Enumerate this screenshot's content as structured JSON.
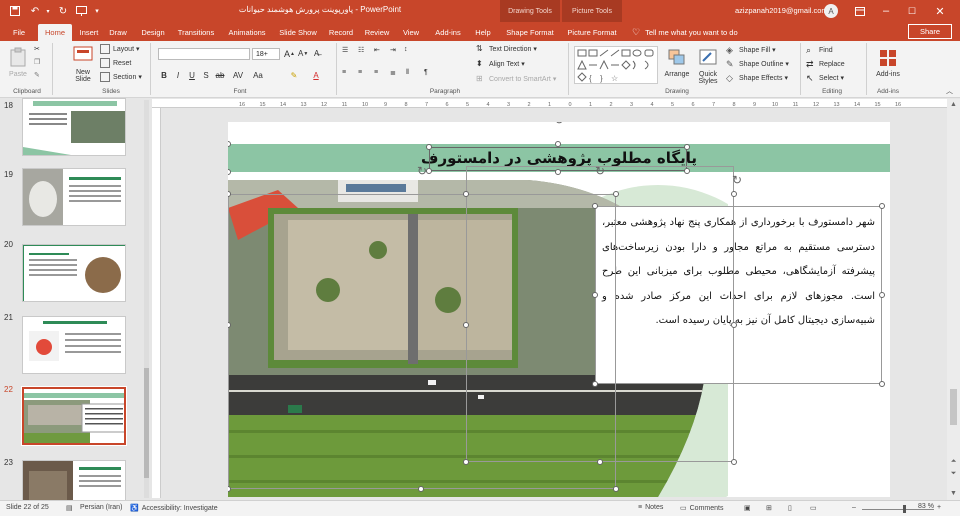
{
  "titlebar": {
    "document_title": "پاورپوینت پرورش هوشمند حیوانات  -  PowerPoint",
    "context_tab_drawing": "Drawing Tools",
    "context_tab_picture": "Picture Tools",
    "user_email": "azizpanah2019@gmail.com",
    "avatar_initial": "A"
  },
  "tabs": {
    "file": "File",
    "home": "Home",
    "insert": "Insert",
    "draw": "Draw",
    "design": "Design",
    "transitions": "Transitions",
    "animations": "Animations",
    "slideshow": "Slide Show",
    "record": "Record",
    "review": "Review",
    "view": "View",
    "addins": "Add-ins",
    "help": "Help",
    "shape_format": "Shape Format",
    "picture_format": "Picture Format",
    "tell_me": "Tell me what you want to do",
    "share": "Share"
  },
  "ribbon": {
    "paste": "Paste",
    "new_slide": "New Slide",
    "layout": "Layout",
    "reset": "Reset",
    "section": "Section",
    "font_size": "18+",
    "text_direction": "Text Direction",
    "align_text": "Align Text",
    "convert_smartart": "Convert to SmartArt",
    "arrange": "Arrange",
    "quick_styles": "Quick Styles",
    "shape_fill": "Shape Fill",
    "shape_outline": "Shape Outline",
    "shape_effects": "Shape Effects",
    "find": "Find",
    "replace": "Replace",
    "select": "Select",
    "addins": "Add-ins",
    "groups": {
      "clipboard": "Clipboard",
      "slides": "Slides",
      "font": "Font",
      "paragraph": "Paragraph",
      "drawing": "Drawing",
      "editing": "Editing",
      "addins": "Add-ins"
    }
  },
  "ruler": {
    "ticks": [
      "16",
      "15",
      "14",
      "13",
      "12",
      "11",
      "10",
      "9",
      "8",
      "7",
      "6",
      "5",
      "4",
      "3",
      "2",
      "1",
      "0",
      "1",
      "2",
      "3",
      "4",
      "5",
      "6",
      "7",
      "8",
      "9",
      "10",
      "11",
      "12",
      "13",
      "14",
      "15",
      "16"
    ]
  },
  "thumbnails": [
    {
      "num": "18"
    },
    {
      "num": "19"
    },
    {
      "num": "20"
    },
    {
      "num": "21"
    },
    {
      "num": "22",
      "selected": true
    },
    {
      "num": "23"
    }
  ],
  "slide": {
    "title": "پایگاه مطلوب پژوهشی در دامستورف",
    "body": "شهر دامستورف با برخورداری از همکاری پنج نهاد پژوهشی معتبر، دسترسی مستقیم به مراتع مجاور و دارا بودن زیرساخت‌های پیشرفته آزمایشگاهی، محیطی مطلوب برای میزبانی این طرح است. مجوزهای لازم برای احداث این مرکز صادر شده و شبیه‌سازی دیجیتال کامل آن نیز به پایان رسیده است."
  },
  "statusbar": {
    "slide_counter": "Slide 22 of 25",
    "language": "Persian (Iran)",
    "accessibility": "Accessibility: Investigate",
    "notes": "Notes",
    "comments": "Comments",
    "zoom": "83 %"
  },
  "colors": {
    "accent": "#c8462a",
    "title_band": "#8cc5a4"
  }
}
